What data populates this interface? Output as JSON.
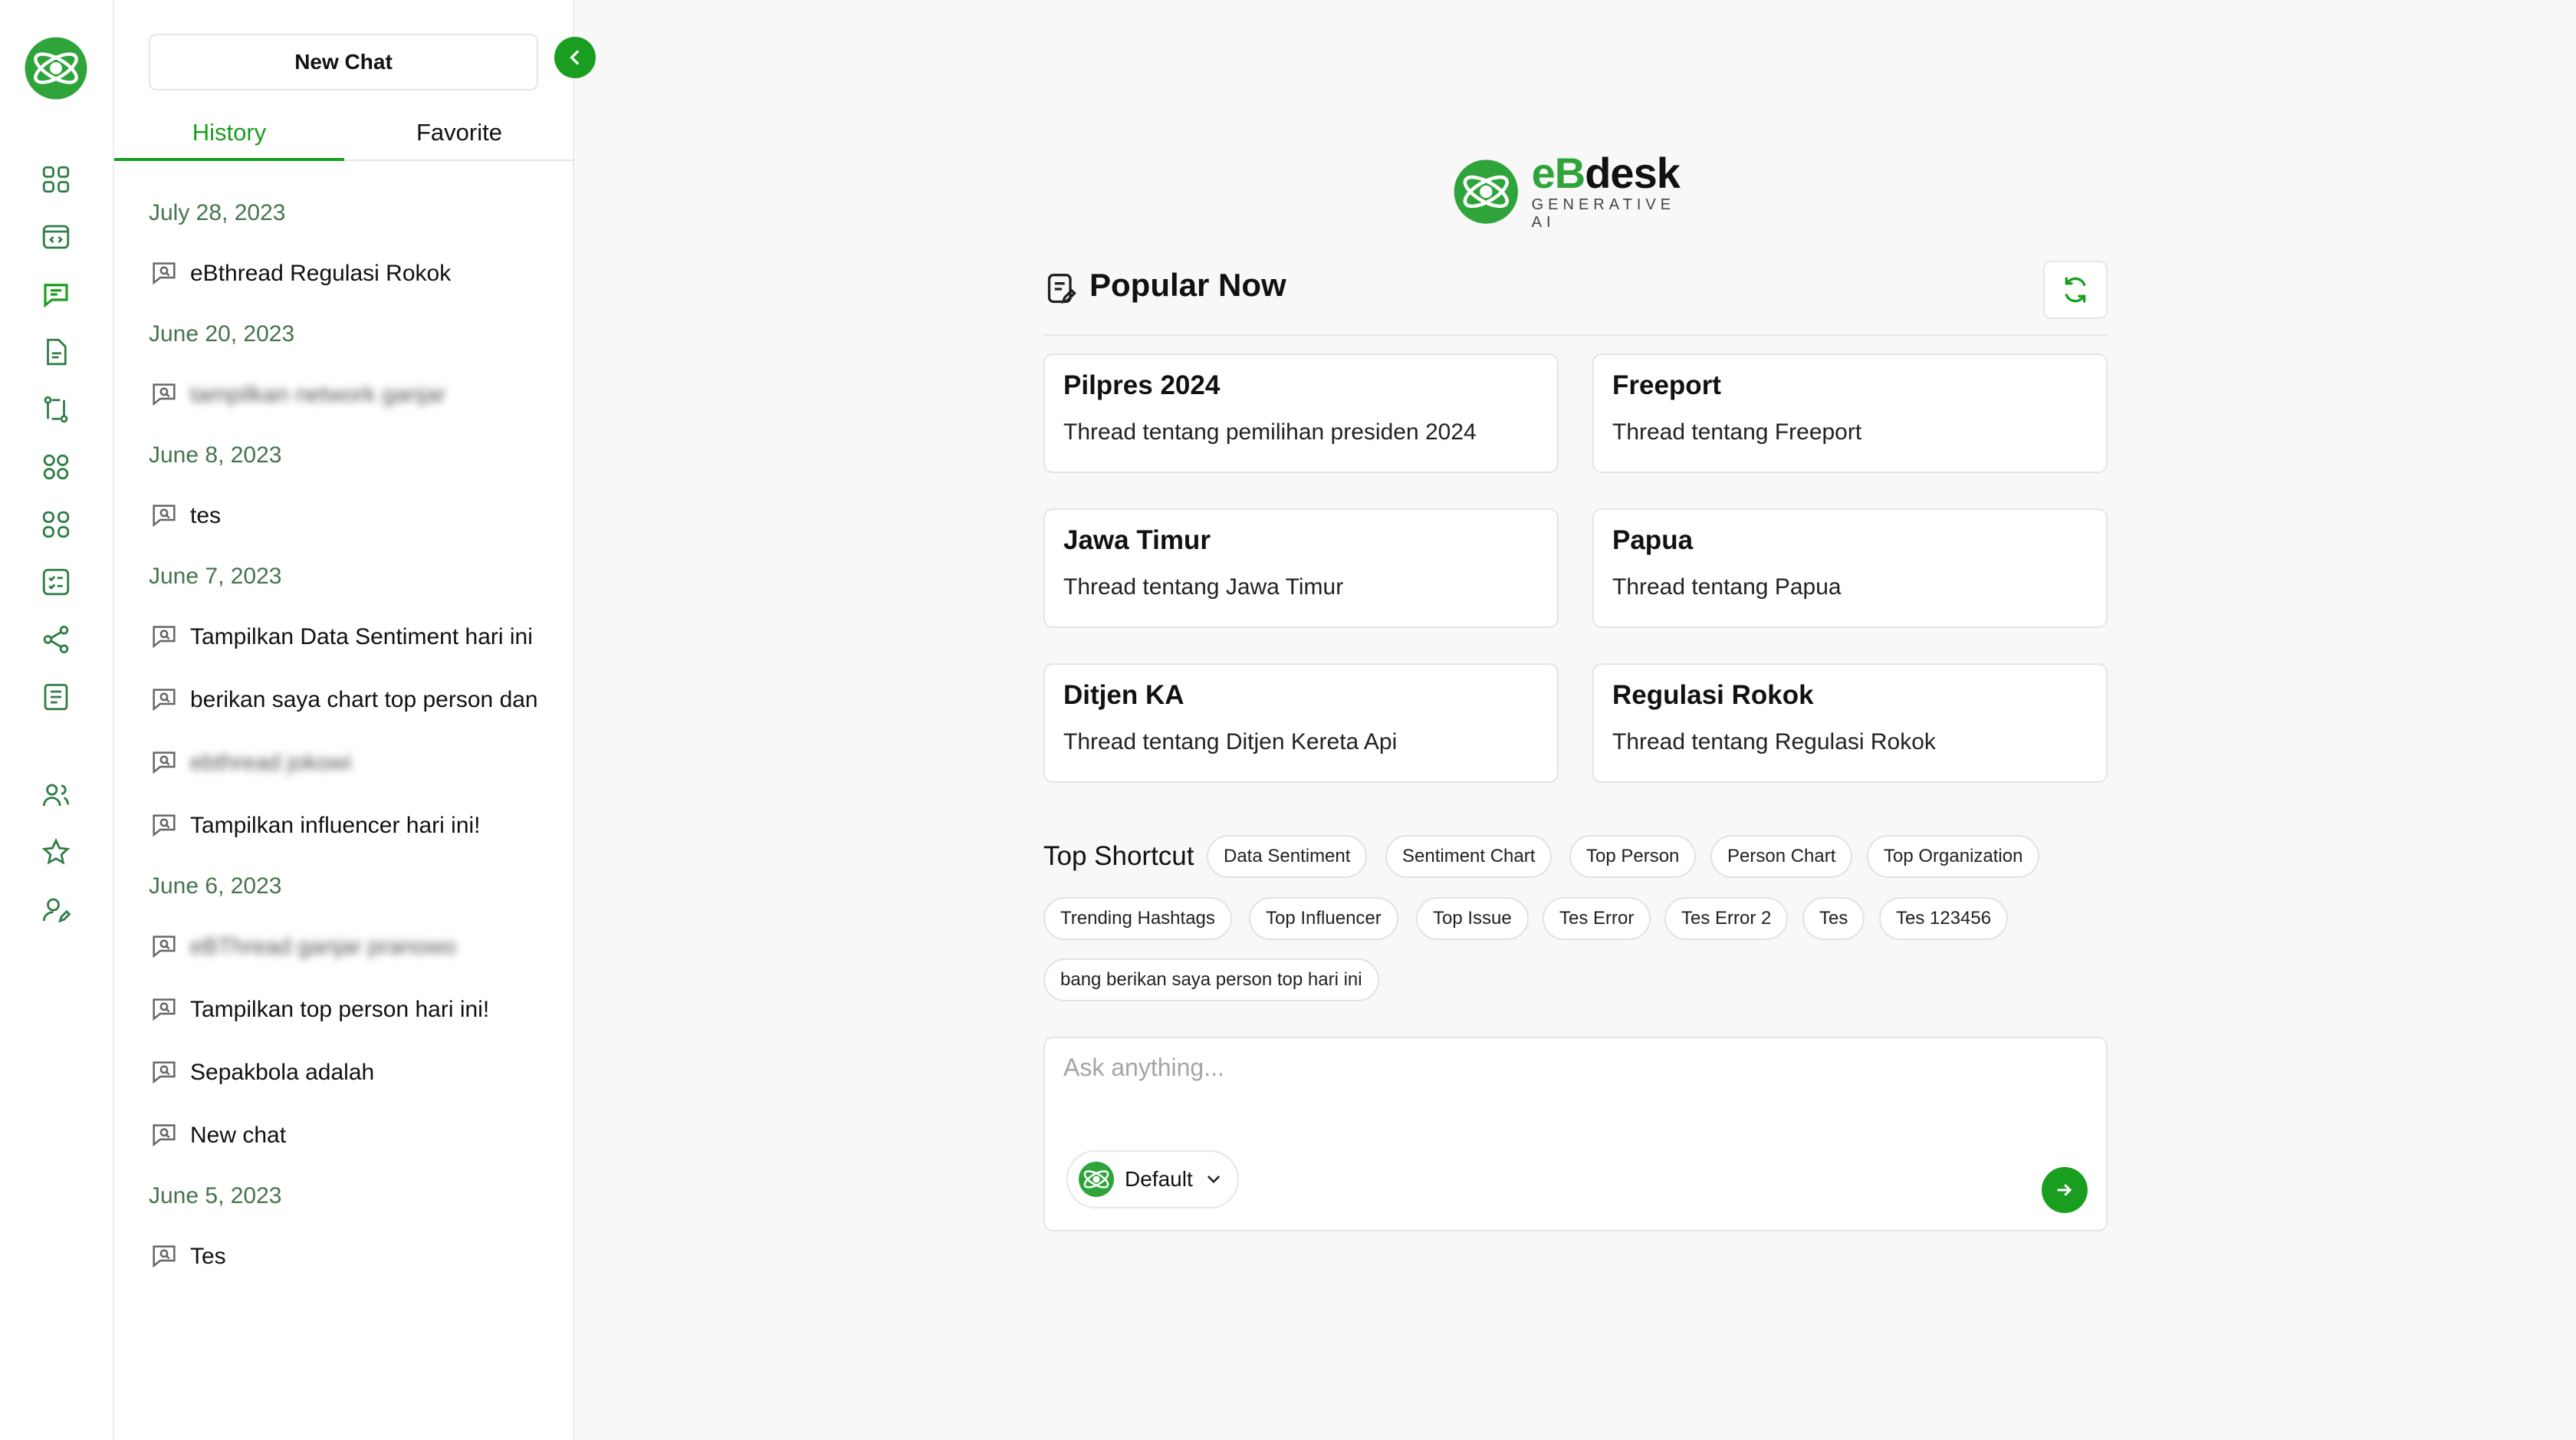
{
  "panel": {
    "new_chat_label": "New Chat",
    "tabs": [
      {
        "label": "History",
        "active": true
      },
      {
        "label": "Favorite",
        "active": false
      }
    ],
    "history": [
      {
        "date": "July 28, 2023",
        "items": [
          "eBthread Regulasi Rokok"
        ]
      },
      {
        "date": "June 20, 2023",
        "items": [
          "tampilkan network ganjar"
        ],
        "blurred": [
          true
        ]
      },
      {
        "date": "June 8, 2023",
        "items": [
          "tes"
        ]
      },
      {
        "date": "June 7, 2023",
        "items": [
          "Tampilkan Data Sentiment hari ini",
          "berikan saya chart top person dan",
          "ebthread jokowi",
          "Tampilkan influencer hari ini!"
        ],
        "blurred": [
          false,
          false,
          true,
          false
        ]
      },
      {
        "date": "June 6, 2023",
        "items": [
          "eBThread ganjar pranowo",
          "Tampilkan top person hari ini!",
          "Sepakbola adalah",
          "New chat"
        ],
        "blurred": [
          true,
          false,
          false,
          false
        ]
      },
      {
        "date": "June 5, 2023",
        "items": [
          "Tes"
        ]
      }
    ]
  },
  "brand": {
    "name_accent": "eB",
    "name_rest": "desk",
    "subtitle": "GENERATIVE AI"
  },
  "popular": {
    "title": "Popular Now",
    "cards": [
      {
        "title": "Pilpres 2024",
        "desc": "Thread tentang pemilihan presiden 2024"
      },
      {
        "title": "Freeport",
        "desc": "Thread tentang Freeport"
      },
      {
        "title": "Jawa Timur",
        "desc": "Thread tentang Jawa Timur"
      },
      {
        "title": "Papua",
        "desc": "Thread tentang Papua"
      },
      {
        "title": "Ditjen KA",
        "desc": "Thread tentang Ditjen Kereta Api"
      },
      {
        "title": "Regulasi Rokok",
        "desc": "Thread tentang Regulasi Rokok"
      }
    ]
  },
  "shortcuts": {
    "title": "Top Shortcut",
    "chips": [
      "Data Sentiment",
      "Sentiment Chart",
      "Top Person",
      "Person Chart",
      "Top Organization",
      "Trending Hashtags",
      "Top Influencer",
      "Top Issue",
      "Tes Error",
      "Tes Error 2",
      "Tes",
      "Tes 123456",
      "bang berikan saya person top hari ini"
    ]
  },
  "composer": {
    "placeholder": "Ask anything...",
    "model_label": "Default"
  },
  "colors": {
    "accent": "#1a9e1f",
    "date_text": "#46744f"
  }
}
